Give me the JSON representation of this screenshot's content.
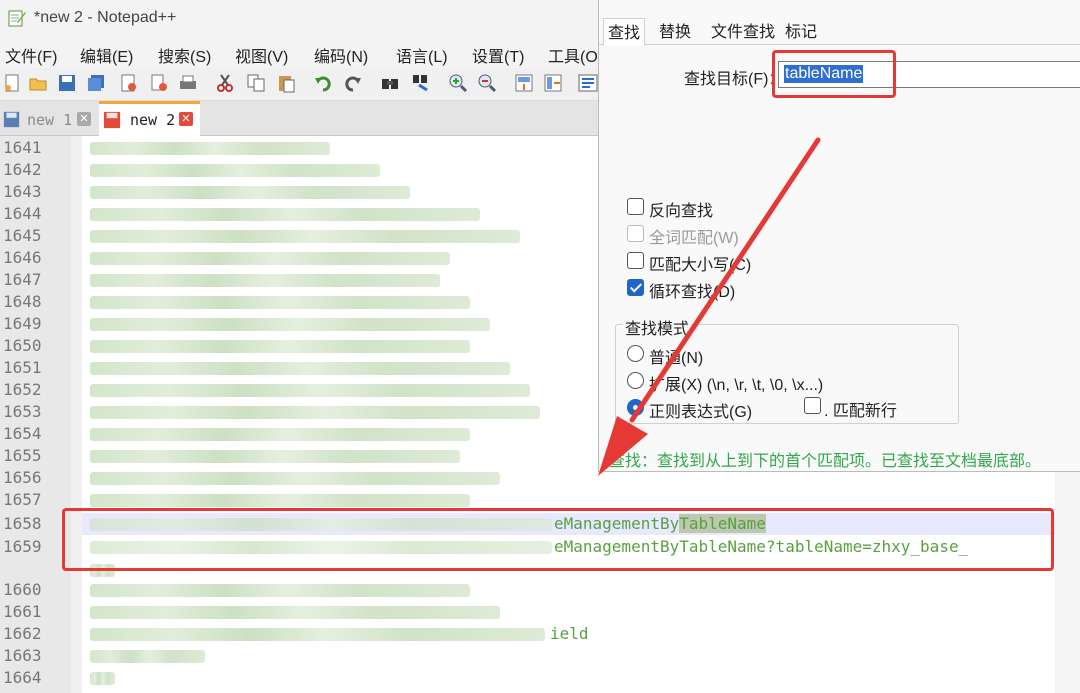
{
  "window": {
    "title": "*new 2 - Notepad++"
  },
  "menu": {
    "items": [
      "文件(F)",
      "编辑(E)",
      "搜索(S)",
      "视图(V)",
      "编码(N)",
      "语言(L)",
      "设置(T)",
      "工具(O"
    ]
  },
  "toolbar": {
    "icons": [
      "new-file-icon",
      "open-file-icon",
      "save-icon",
      "save-all-icon",
      "close-icon",
      "close-all-icon",
      "print-icon",
      "cut-icon",
      "copy-icon",
      "paste-icon",
      "undo-icon",
      "redo-icon",
      "find-icon",
      "replace-icon",
      "zoom-in-icon",
      "zoom-out-icon",
      "sync-v-icon",
      "sync-h-icon",
      "wrap-icon"
    ]
  },
  "tabs": [
    {
      "label": "new 1",
      "active": false
    },
    {
      "label": "new 2",
      "active": true
    }
  ],
  "editor": {
    "lines": [
      {
        "n": "1641"
      },
      {
        "n": "1642"
      },
      {
        "n": "1643"
      },
      {
        "n": "1644"
      },
      {
        "n": "1645"
      },
      {
        "n": "1646"
      },
      {
        "n": "1647"
      },
      {
        "n": "1648"
      },
      {
        "n": "1649"
      },
      {
        "n": "1650"
      },
      {
        "n": "1651"
      },
      {
        "n": "1652"
      },
      {
        "n": "1653"
      },
      {
        "n": "1654"
      },
      {
        "n": "1655"
      },
      {
        "n": "1656"
      },
      {
        "n": "1657"
      },
      {
        "n": "1658",
        "text_a": "eManagementBy",
        "match": "TableName"
      },
      {
        "n": "1659",
        "text": "eManagementByTableName?tableName=zhxy_base_"
      },
      {
        "n": "1660"
      },
      {
        "n": "1661"
      },
      {
        "n": "1662",
        "text": "ield"
      },
      {
        "n": "1663"
      },
      {
        "n": "1664"
      }
    ]
  },
  "find_dialog": {
    "tabs": [
      "查找",
      "替换",
      "文件查找",
      "标记"
    ],
    "find_label": "查找目标(F)：",
    "find_value": "tableName",
    "options": {
      "reverse": {
        "label": "反向查找",
        "checked": false
      },
      "whole_word": {
        "label": "全词匹配(W)",
        "checked": false,
        "disabled": true
      },
      "match_case": {
        "label": "匹配大小写(C)",
        "checked": false
      },
      "wrap": {
        "label": "循环查找(D)",
        "checked": true
      }
    },
    "mode": {
      "title": "查找模式",
      "normal": "普通(N)",
      "extended": "扩展(X) (\\n, \\r, \\t, \\0, \\x...)",
      "regex": "正则表达式(G)",
      "selected": "regex",
      "dot_newline": ". 匹配新行"
    },
    "status": "查找：查找到从上到下的首个匹配项。已查找至文档最底部。"
  },
  "colors": {
    "annotation_red": "#e53935",
    "code_green": "#58a140",
    "status_green": "#33a84a",
    "selection_blue": "#2f6fd1"
  }
}
